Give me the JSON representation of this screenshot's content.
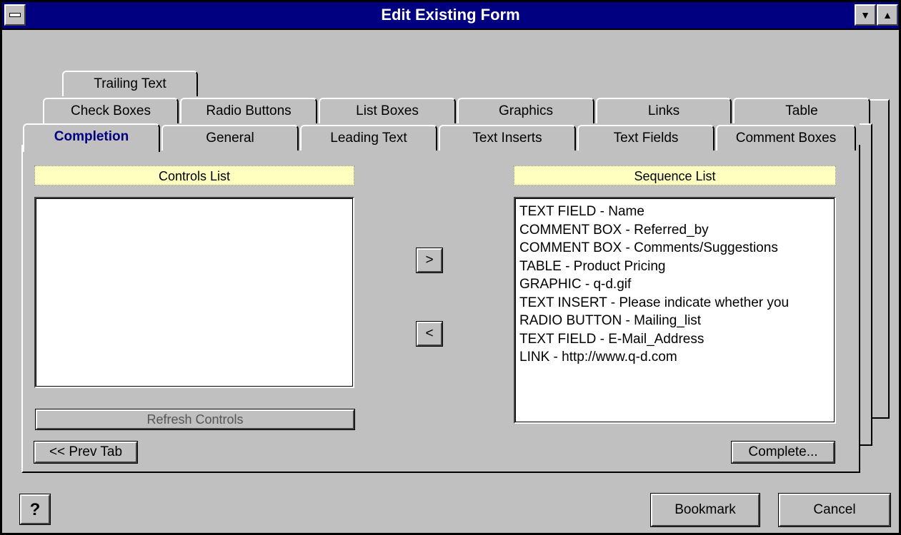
{
  "window": {
    "title": "Edit Existing Form"
  },
  "tabs": {
    "row1": [
      "Trailing Text"
    ],
    "row2": [
      "Check Boxes",
      "Radio Buttons",
      "List Boxes",
      "Graphics",
      "Links",
      "Table"
    ],
    "row3": [
      "Completion",
      "General",
      "Leading Text",
      "Text Inserts",
      "Text Fields",
      "Comment Boxes"
    ],
    "active": "Completion"
  },
  "controls": {
    "header": "Controls List",
    "items": [],
    "refresh_label": "Refresh Controls"
  },
  "sequence": {
    "header": "Sequence List",
    "items": [
      {
        "type": "TEXT FIELD",
        "name": "- Name"
      },
      {
        "type": "COMMENT BOX",
        "name": "- Referred_by"
      },
      {
        "type": "COMMENT BOX",
        "name": "- Comments/Suggestions"
      },
      {
        "type": "TABLE",
        "name": "- Product Pricing"
      },
      {
        "type": "GRAPHIC",
        "name": "- q-d.gif"
      },
      {
        "type": "TEXT INSERT",
        "name": "- Please indicate whether you"
      },
      {
        "type": "RADIO BUTTON",
        "name": "- Mailing_list"
      },
      {
        "type": "TEXT FIELD",
        "name": "- E-Mail_Address"
      },
      {
        "type": "LINK",
        "name": "- http://www.q-d.com"
      }
    ]
  },
  "buttons": {
    "move_right": ">",
    "move_left": "<",
    "prev_tab": "<< Prev Tab",
    "complete": "Complete...",
    "bookmark": "Bookmark",
    "cancel": "Cancel",
    "help": "?"
  }
}
